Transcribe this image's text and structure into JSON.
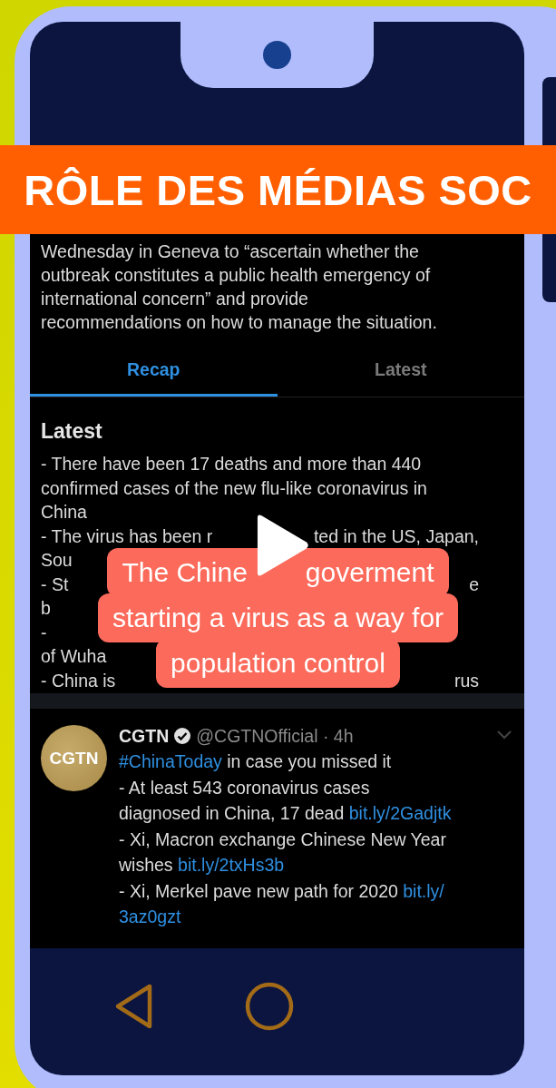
{
  "banner": {
    "text": "RÔLE DES MÉDIAS SOC"
  },
  "article": {
    "lines": [
      "Wednesday in Geneva to “ascertain whether the",
      "outbreak constitutes a public health emergency of",
      "international concern” and provide",
      "recommendations on how to manage the situation."
    ]
  },
  "tabs": [
    {
      "label": "Recap",
      "selected": true
    },
    {
      "label": "Latest",
      "selected": false
    }
  ],
  "latest": {
    "heading": "Latest",
    "lines": [
      {
        "left": "- There have been 17 deaths and more than 440"
      },
      {
        "left": "confirmed cases of the new flu-like coronavirus in"
      },
      {
        "left": "China"
      },
      {
        "left": "- The virus has been r",
        "right": "ted in the US, Japan,"
      },
      {
        "left": "Sou"
      },
      {
        "left": "- St",
        "right": "e"
      },
      {
        "left": "b"
      },
      {
        "left": "-"
      },
      {
        "left": "of Wuha"
      },
      {
        "left": "- China is",
        "right": "rus"
      }
    ]
  },
  "caption": {
    "lines": [
      {
        "left": "The Chine",
        "right": "goverment"
      },
      {
        "left": "starting a virus as a way for"
      },
      {
        "left": "population control"
      }
    ]
  },
  "tweet": {
    "avatar_text": "CGTN",
    "name": "CGTN",
    "verified": true,
    "handle": "@CGTNOfficial · 4h",
    "lines": [
      [
        {
          "kind": "link",
          "text": "#ChinaToday"
        },
        {
          "kind": "text",
          "text": " in case you missed it"
        }
      ],
      [
        {
          "kind": "text",
          "text": "- At least 543 coronavirus cases"
        }
      ],
      [
        {
          "kind": "text",
          "text": "diagnosed in China, 17 dead "
        },
        {
          "kind": "link",
          "text": "bit.ly/2Gadjtk"
        }
      ],
      [
        {
          "kind": "text",
          "text": "- Xi, Macron exchange Chinese New Year"
        }
      ],
      [
        {
          "kind": "text",
          "text": "wishes "
        },
        {
          "kind": "link",
          "text": "bit.ly/2txHs3b"
        }
      ],
      [
        {
          "kind": "text",
          "text": "- Xi, Merkel pave new path for 2020 "
        },
        {
          "kind": "link",
          "text": "bit.ly/"
        }
      ],
      [
        {
          "kind": "link",
          "text": "3az0gzt"
        }
      ]
    ]
  }
}
